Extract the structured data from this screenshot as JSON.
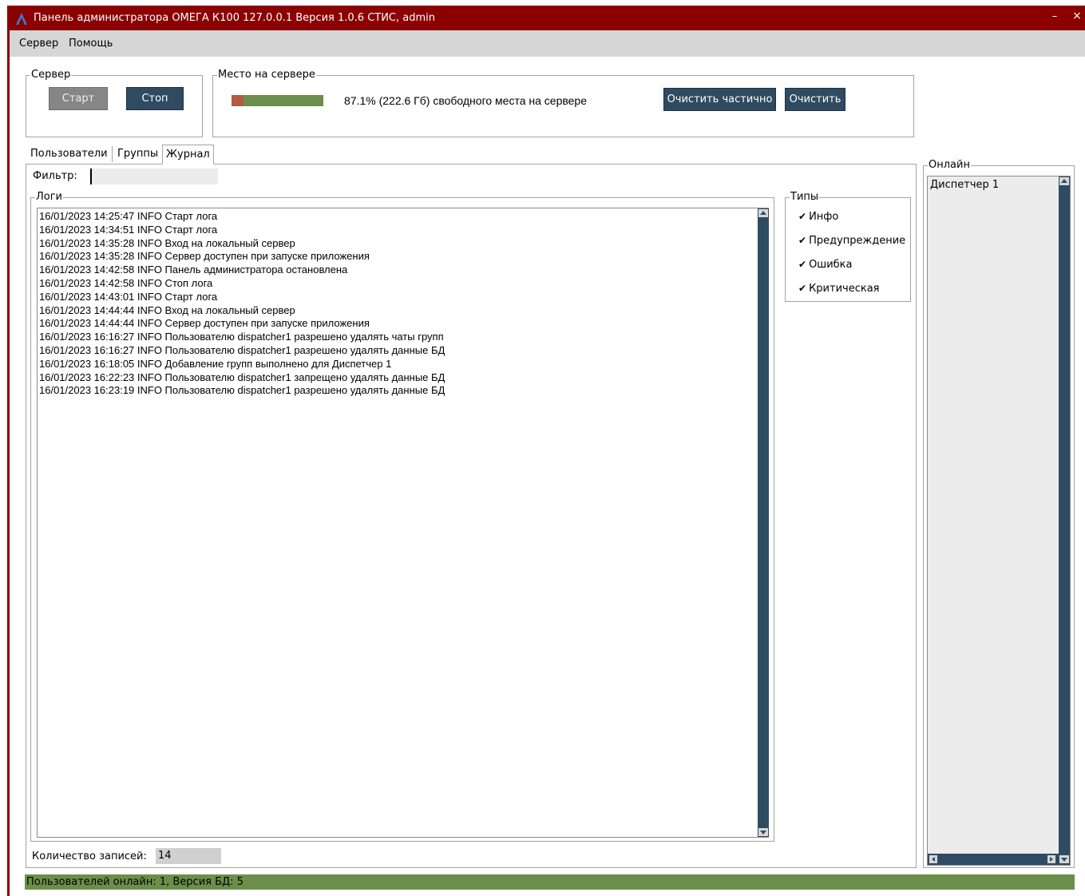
{
  "window": {
    "title": "Панель администратора ОМЕГА К100 127.0.0.1 Версия 1.0.6 СТИС, admin",
    "logo_icon": "omega-logo-icon",
    "minimize_label": "–",
    "close_label": "×"
  },
  "menu": [
    {
      "label": "Сервер"
    },
    {
      "label": "Помощь"
    }
  ],
  "server_group": {
    "title": "Сервер",
    "start_label": "Старт",
    "stop_label": "Стоп"
  },
  "space_group": {
    "title": "Место на сервере",
    "used_fraction": 0.129,
    "free_fraction": 0.871,
    "used_color": "#b35a3f",
    "free_color": "#6b8f4a",
    "status_text": "87.1% (222.6 Гб) свободного места на сервере",
    "clear_partial_label": "Очистить частично",
    "clear_label": "Очистить"
  },
  "tabs": [
    {
      "label": "Пользователи"
    },
    {
      "label": "Группы"
    },
    {
      "label": "Журнал",
      "active": true
    }
  ],
  "journal": {
    "filter_label": "Фильтр:",
    "filter_value": "",
    "logs_title": "Логи",
    "logs": [
      "16/01/2023 14:25:47 INFO Старт лога",
      "16/01/2023 14:34:51 INFO Старт лога",
      "16/01/2023 14:35:28 INFO Вход на локальный сервер",
      "16/01/2023 14:35:28 INFO Сервер доступен при запуске приложения",
      "16/01/2023 14:42:58 INFO Панель администратора остановлена",
      "16/01/2023 14:42:58 INFO Стоп лога",
      "16/01/2023 14:43:01 INFO Старт лога",
      "16/01/2023 14:44:44 INFO Вход на локальный сервер",
      "16/01/2023 14:44:44 INFO Сервер доступен при запуске приложения",
      "16/01/2023 16:16:27 INFO Пользователю dispatcher1 разрешено удалять чаты групп",
      "16/01/2023 16:16:27 INFO Пользователю dispatcher1 разрешено удалять данные БД",
      "16/01/2023 16:18:05 INFO Добавление групп выполнено для Диспетчер 1",
      "16/01/2023 16:22:23 INFO Пользователю dispatcher1 запрещено удалять данные БД",
      "16/01/2023 16:23:19 INFO Пользователю dispatcher1 разрешено удалять данные БД"
    ],
    "types_title": "Типы",
    "types": [
      {
        "label": "Инфо",
        "checked": true,
        "mark": "✔"
      },
      {
        "label": "Предупреждение",
        "checked": true,
        "mark": "✔"
      },
      {
        "label": "Ошибка",
        "checked": true,
        "mark": "✔"
      },
      {
        "label": "Критическая",
        "checked": true,
        "mark": "✔"
      }
    ],
    "count_label": "Количество записей:",
    "count_value": "14"
  },
  "online": {
    "title": "Онлайн",
    "users": [
      "Диспетчер 1"
    ]
  },
  "statusbar": {
    "text": "Пользователей онлайн: 1, Версия БД: 5",
    "color": "#6b8f4a"
  }
}
